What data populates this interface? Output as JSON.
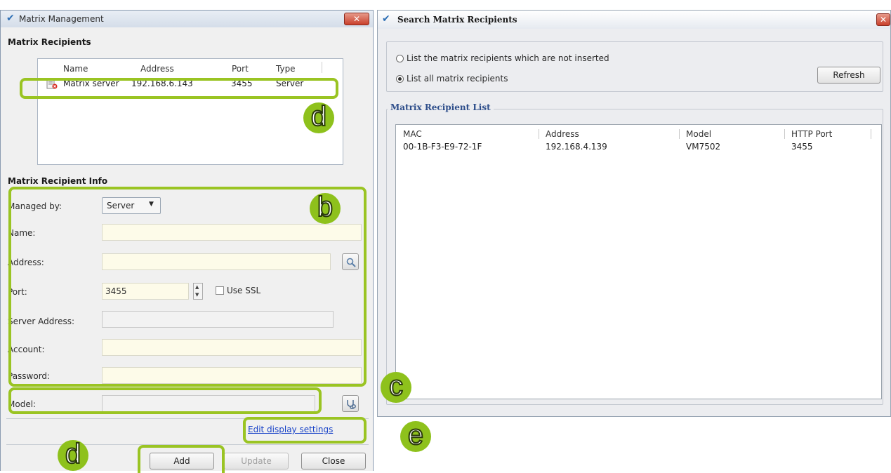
{
  "left_window": {
    "title": "Matrix Management",
    "close_label": "✕",
    "recipients_section_title": "Matrix Recipients",
    "list_columns": [
      "Name",
      "Address",
      "Port",
      "Type"
    ],
    "list_rows": [
      {
        "name": "Matrix server",
        "address": "192.168.6.143",
        "port": "3455",
        "type": "Server"
      }
    ],
    "info_section_title": "Matrix Recipient Info",
    "fields": {
      "managed_by_label": "Managed by:",
      "managed_by_value": "Server",
      "name_label": "Name:",
      "address_label": "Address:",
      "port_label": "Port:",
      "port_value": "3455",
      "use_ssl_label": "Use SSL",
      "server_address_label": "Server Address:",
      "account_label": "Account:",
      "password_label": "Password:",
      "model_label": "Model:"
    },
    "edit_display_link": "Edit display settings",
    "buttons": {
      "add": "Add",
      "update": "Update",
      "close": "Close"
    }
  },
  "right_window": {
    "title": "Search Matrix Recipients",
    "close_label": "✕",
    "radio_not_inserted": "List the matrix recipients which are not inserted",
    "radio_all": "List all matrix recipients",
    "radio_selected": "all",
    "refresh_label": "Refresh",
    "group_title": "Matrix Recipient List",
    "columns": [
      "MAC",
      "Address",
      "Model",
      "HTTP Port"
    ],
    "rows": [
      {
        "mac": "00-1B-F3-E9-72-1F",
        "address": "192.168.4.139",
        "model": "VM7502",
        "http_port": "3455"
      }
    ]
  },
  "annotations": {
    "d_top": "d",
    "b": "b",
    "c": "c",
    "e": "e",
    "d_bottom": "d"
  },
  "colors": {
    "highlight": "#9ac423",
    "badge_fill": "#8ec11c",
    "link": "#1a44c8"
  }
}
